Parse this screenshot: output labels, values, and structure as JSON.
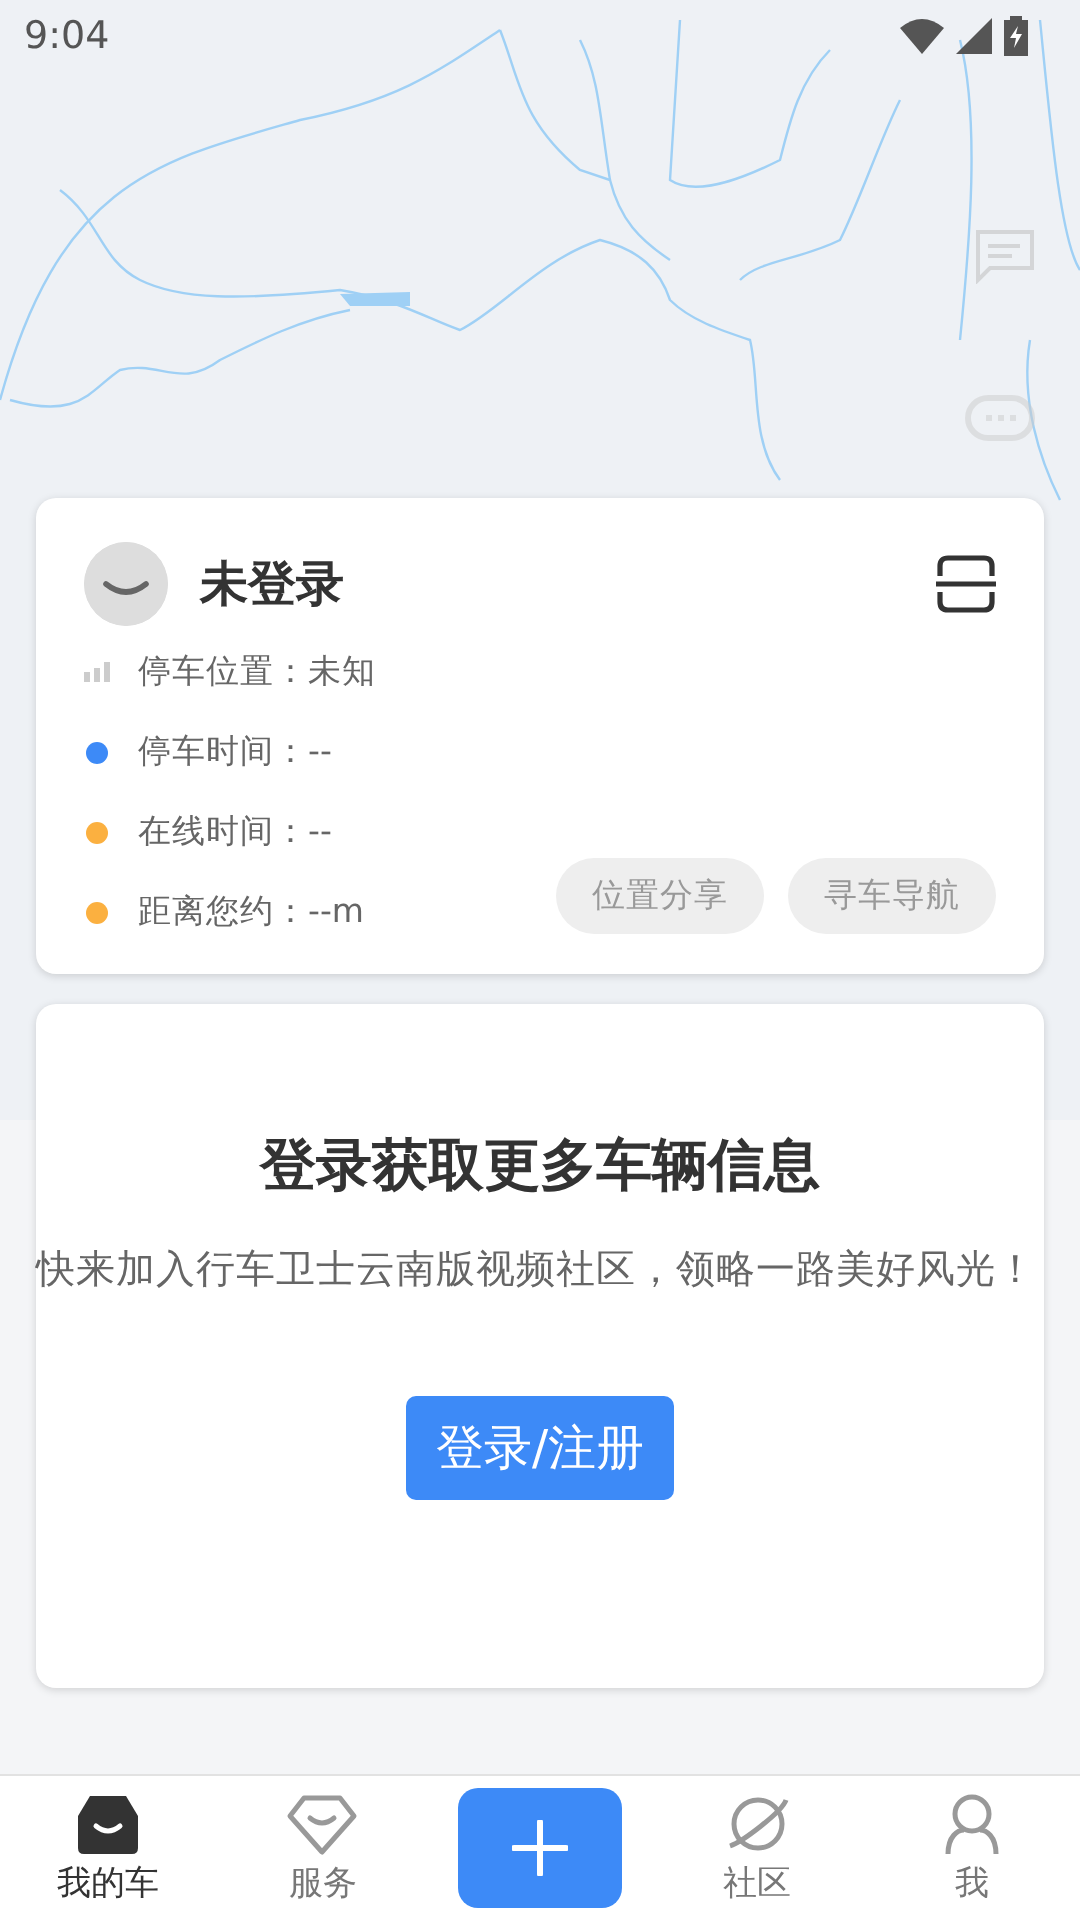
{
  "status_bar": {
    "time": "9:04"
  },
  "vehicle_card": {
    "user_name": "未登录",
    "rows": [
      {
        "kind": "signal",
        "text": "停车位置：未知"
      },
      {
        "kind": "dot",
        "color": "#3d8af7",
        "text": "停车时间：--"
      },
      {
        "kind": "dot",
        "color": "#fbb040",
        "text": "在线时间：--"
      },
      {
        "kind": "dot",
        "color": "#fbb040",
        "text": "距离您约：--m"
      }
    ],
    "buttons": [
      "位置分享",
      "寻车导航"
    ]
  },
  "login_card": {
    "title": "登录获取更多车辆信息",
    "message": "快来加入行车卫士云南版视频社区，领略一路美好风光！",
    "button": "登录/注册"
  },
  "bottom_nav": [
    {
      "kind": "tab",
      "label": "我的车",
      "selected": true
    },
    {
      "kind": "tab",
      "label": "服务",
      "selected": false
    },
    {
      "kind": "add"
    },
    {
      "kind": "tab",
      "label": "社区",
      "selected": false
    },
    {
      "kind": "tab",
      "label": "我",
      "selected": false
    }
  ]
}
